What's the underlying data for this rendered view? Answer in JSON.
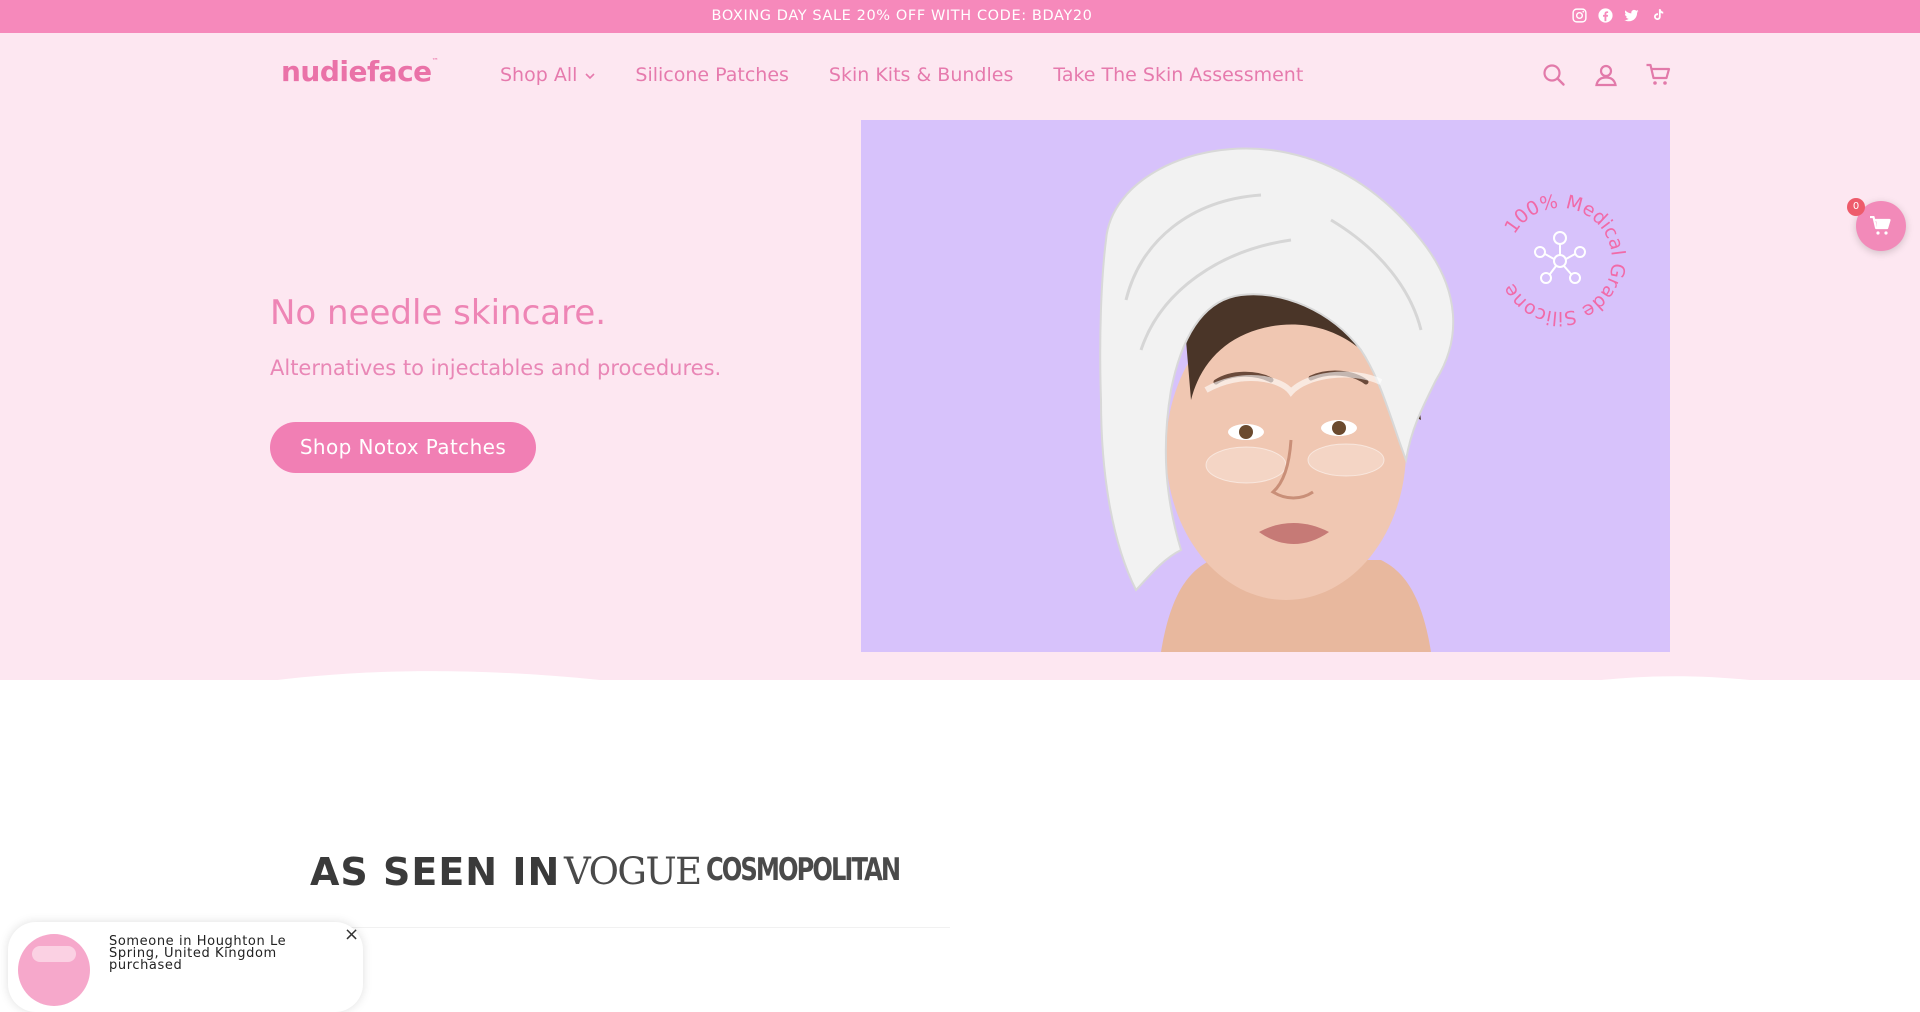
{
  "announcement": {
    "text": "BOXING DAY SALE 20% OFF WITH CODE: BDAY20",
    "social": [
      "instagram-icon",
      "facebook-icon",
      "twitter-icon",
      "tiktok-icon"
    ]
  },
  "header": {
    "logo": "nudieface",
    "nav": [
      {
        "label": "Shop All",
        "has_dropdown": true
      },
      {
        "label": "Silicone Patches"
      },
      {
        "label": "Skin Kits & Bundles"
      },
      {
        "label": "Take The Skin Assessment"
      }
    ],
    "icons": [
      "search-icon",
      "account-icon",
      "cart-icon"
    ]
  },
  "hero": {
    "headline": "No needle skincare.",
    "subheadline": "Alternatives to injectables and procedures.",
    "cta": "Shop Notox Patches",
    "badge_text": "100% Medical Grade Silicone"
  },
  "floating_cart": {
    "count": "0"
  },
  "press": {
    "heading": "AS SEEN IN",
    "logos": [
      "VOGUE",
      "COSMOPOLITAN"
    ]
  },
  "popup": {
    "text": "Someone in Houghton Le Spring, United Kingdom purchased",
    "close": "×"
  },
  "colors": {
    "announcement_bg": "#f689bb",
    "header_bg": "#fde7f1",
    "accent_pink": "#f17fb4",
    "hero_image_bg": "#d7c2fb"
  }
}
